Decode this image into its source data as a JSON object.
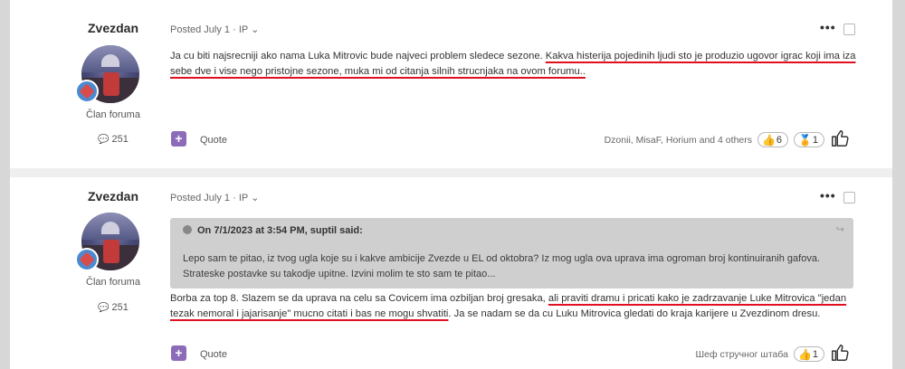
{
  "posts": [
    {
      "author": "Zvezdan",
      "author_title": "Član foruma",
      "post_count": "251",
      "meta": "Posted July 1 · IP ⌄",
      "content_plain": "Ja cu biti najsrecniji ako nama Luka Mitrovic bude najveci problem sledece sezone. ",
      "content_underlined": "Kakva histerija pojedinih ljudi sto je produzio ugovor igrac koji ima iza sebe dve i vise nego pristojne sezone, muka mi od citanja silnih strucnjaka na ovom forumu..",
      "action_quote": "Quote",
      "reactors": "Dzonii, MisaF, Horium and 4 others",
      "reactions": [
        {
          "icon": "thumbs-up",
          "glyph": "👍",
          "count": "6"
        },
        {
          "icon": "medal",
          "glyph": "🏅",
          "count": "1"
        }
      ]
    },
    {
      "author": "Zvezdan",
      "author_title": "Član foruma",
      "post_count": "251",
      "meta": "Posted July 1 · IP ⌄",
      "quote": {
        "header": "On 7/1/2023 at 3:54 PM, suptil said:",
        "body": "Lepo sam te pitao, iz tvog ugla koje su i kakve ambicije Zvezde u EL od oktobra?  Iz mog ugla ova uprava ima ogroman broj kontinuiranih gafova. Strateske postavke su takodje upitne. Izvini molim te sto sam te pitao..."
      },
      "content_part1": "Borba za top 8. Slazem se da uprava na celu sa Covicem ima ozbiljan broj gresaka, ",
      "content_underlined": "ali praviti dramu i pricati kako je zadrzavanje Luke Mitrovica \"jedan tezak nemoral i jajarisanje\" mucno citati i bas ne mogu shvatiti",
      "content_part2": ". Ja se nadam se da cu Luku Mitrovica gledati do kraja karijere u Zvezdinom dresu.",
      "action_quote": "Quote",
      "reactors": "Шеф стручног штаба",
      "reactions": [
        {
          "icon": "thumbs-up",
          "glyph": "👍",
          "count": "1"
        }
      ]
    }
  ],
  "icons": {
    "more": "•••",
    "plus": "+",
    "like": "👍",
    "chat": "💬"
  },
  "colors": {
    "accent": "#8c6bb8",
    "underline": "#e01020",
    "rank_badge": "#4b8ad0"
  }
}
